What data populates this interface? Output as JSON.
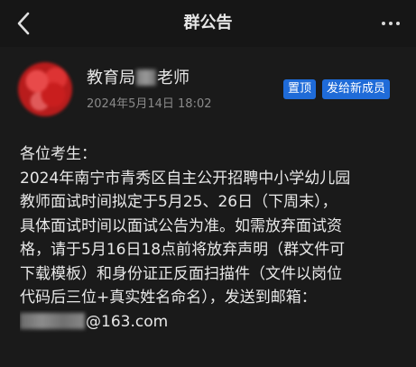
{
  "header": {
    "title": "群公告"
  },
  "author": {
    "name_prefix": "教育局",
    "name_suffix": "老师",
    "time": "2024年5月14日 18:02"
  },
  "badges": {
    "pinned": "置顶",
    "sent_to_new_members": "发给新成员"
  },
  "announcement": {
    "lines": [
      "各位考生：",
      "2024年南宁市青秀区自主公开招聘中小学幼儿园",
      "教师面试时间拟定于5月25、26日（下周末），",
      "具体面试时间以面试公告为准。如需放弃面试资",
      "格，请于5月16日18点前将放弃声明（群文件可",
      "下载模板）和身份证正反面扫描件（文件以岗位",
      "代码后三位+真实姓名命名），发送到邮箱："
    ],
    "email_domain": "@163.com"
  }
}
